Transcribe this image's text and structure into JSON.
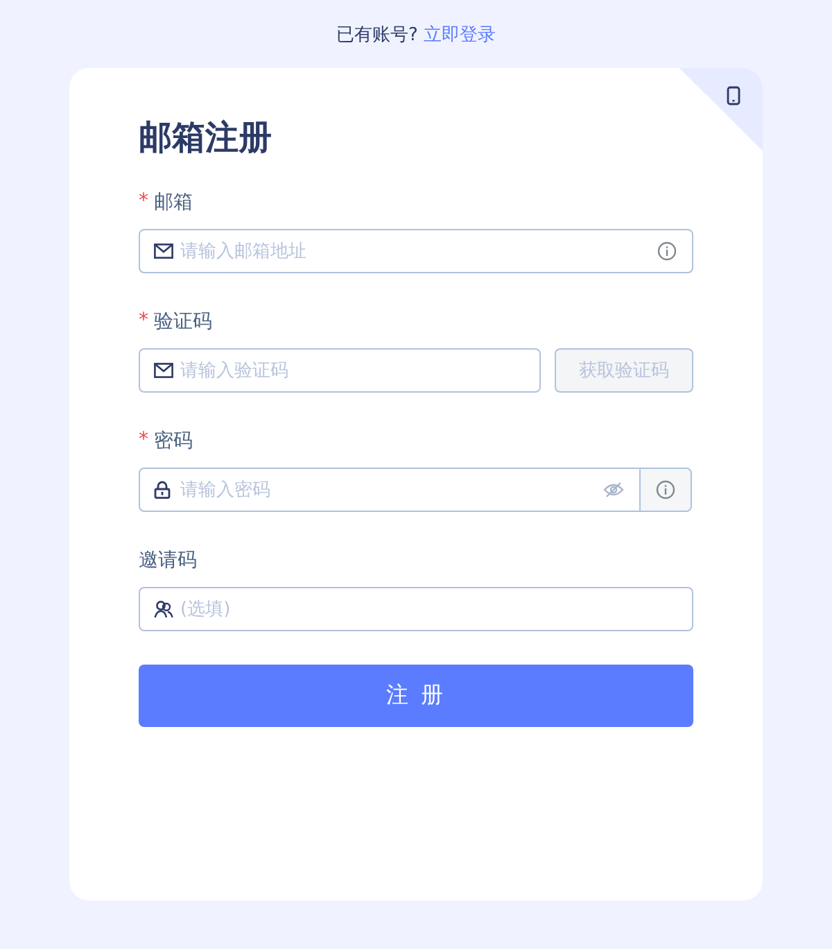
{
  "top_prompt": {
    "text": "已有账号?",
    "link": "立即登录"
  },
  "title": "邮箱注册",
  "fields": [
    {
      "kind": "email",
      "label": "邮箱",
      "required": true,
      "placeholder": "请输入邮箱地址"
    },
    {
      "kind": "code",
      "label": "验证码",
      "required": true,
      "placeholder": "请输入验证码",
      "button": {
        "label": "获取验证码",
        "disabled": true
      }
    },
    {
      "kind": "password",
      "label": "密码",
      "required": true,
      "placeholder": "请输入密码"
    },
    {
      "kind": "invite",
      "label": "邀请码",
      "required": false,
      "placeholder": "(选填)"
    }
  ],
  "required_mark": "*",
  "submit": "注 册"
}
